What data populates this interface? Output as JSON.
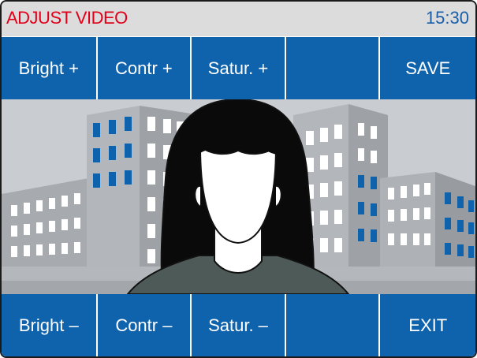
{
  "header": {
    "title": "ADJUST VIDEO",
    "time": "15:30"
  },
  "top_buttons": [
    {
      "label": "Bright +"
    },
    {
      "label": "Contr +"
    },
    {
      "label": "Satur. +"
    },
    {
      "label": ""
    },
    {
      "label": "SAVE"
    }
  ],
  "bottom_buttons": [
    {
      "label": "Bright –"
    },
    {
      "label": "Contr –"
    },
    {
      "label": "Satur. –"
    },
    {
      "label": ""
    },
    {
      "label": "EXIT"
    }
  ],
  "colors": {
    "button_bg": "#0f63ad",
    "button_text": "#ffffff",
    "title_text": "#e0001a",
    "time_text": "#1a5fa8",
    "header_bg": "#dcdcdc"
  }
}
